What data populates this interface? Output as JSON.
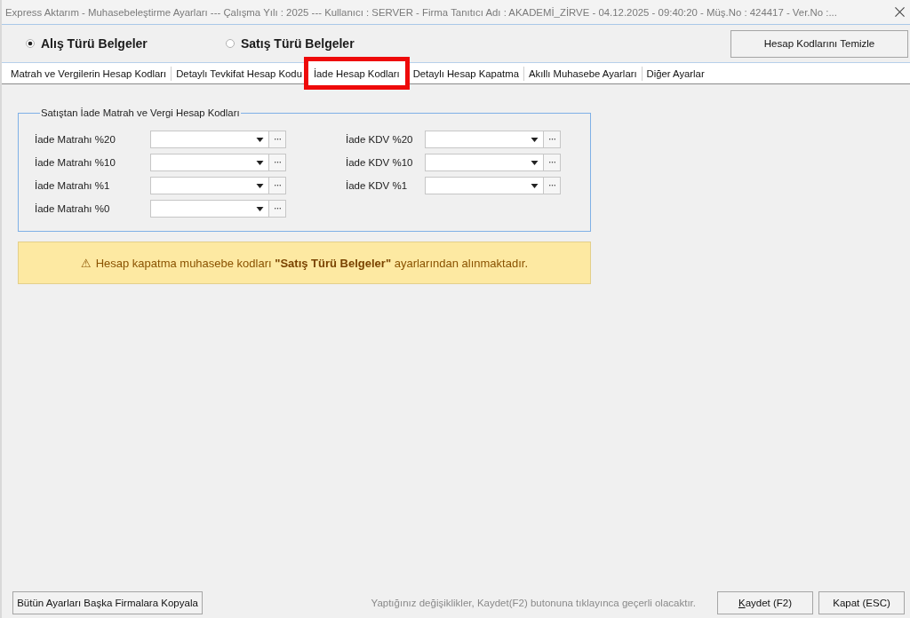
{
  "window": {
    "title": "Express Aktarım - Muhasebeleştirme Ayarları  ---  Çalışma Yılı : 2025  ---  Kullanıcı : SERVER - Firma Tanıtıcı Adı : AKADEMİ_ZİRVE - 04.12.2025 - 09:40:20 - Müş.No : 424417 - Ver.No :..."
  },
  "document_types": [
    {
      "label": "Alış Türü Belgeler",
      "selected": true
    },
    {
      "label": "Satış Türü Belgeler",
      "selected": false
    }
  ],
  "clear_button": "Hesap Kodlarını Temizle",
  "tabs": [
    {
      "label": "Matrah ve Vergilerin Hesap Kodları",
      "selected": false
    },
    {
      "label": "Detaylı Tevkifat Hesap Kodu",
      "selected": false
    },
    {
      "label": "İade Hesap Kodları",
      "selected": true
    },
    {
      "label": "Detaylı Hesap Kapatma",
      "selected": false
    },
    {
      "label": "Akıllı Muhasebe Ayarları",
      "selected": false
    },
    {
      "label": "Diğer Ayarlar",
      "selected": false
    }
  ],
  "group": {
    "legend": "Satıştan İade Matrah ve Vergi Hesap Kodları",
    "columns": [
      [
        {
          "label": "İade Matrahı %20"
        },
        {
          "label": "İade Matrahı %10"
        },
        {
          "label": "İade Matrahı %1"
        },
        {
          "label": "İade Matrahı %0"
        }
      ],
      [
        {
          "label": "İade KDV %20"
        },
        {
          "label": "İade KDV %10"
        },
        {
          "label": "İade KDV %1"
        }
      ]
    ]
  },
  "notice": {
    "icon": "⚠",
    "text": "Hesap kapatma muhasebe kodları **\"Satış Türü Belgeler\"** ayarlarından alınmaktadır."
  },
  "footer": {
    "copy_button": "Bütün Ayarları Başka Firmalara Kopyala",
    "hint": "Yaptığınız değişiklikler, Kaydet(F2) butonuna tıklayınca geçerli olacaktır.",
    "buttons": [
      {
        "label": "Kaydet (F2)",
        "mnemonic": true
      },
      {
        "label": "Kapat (ESC)",
        "mnemonic": false
      }
    ]
  }
}
